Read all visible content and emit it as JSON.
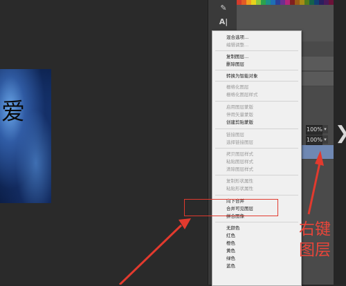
{
  "canvas": {
    "artwork_text": "爱"
  },
  "tools": {
    "text_tool_label": "A|"
  },
  "swatch_colors": [
    "#d23b2c",
    "#e35a25",
    "#f0a020",
    "#e7d21c",
    "#8cc63f",
    "#2ba24c",
    "#1d8f87",
    "#1e6fb4",
    "#2b3f97",
    "#6d2f90",
    "#b3267a",
    "#7f1f1f",
    "#9a5a16",
    "#a78b16",
    "#4f7d1d",
    "#14624a",
    "#123f73",
    "#2a1f5f",
    "#4a1a5a",
    "#6b1238"
  ],
  "layers_panel": {
    "opacity_1": "100%",
    "opacity_2": "100%",
    "dropdown_glyph": "▾"
  },
  "menu": {
    "items": [
      {
        "label": "混合选项...",
        "enabled": true
      },
      {
        "label": "编辑调整...",
        "enabled": false
      },
      {
        "label": "复制图层...",
        "enabled": true
      },
      {
        "label": "删除图层",
        "enabled": true
      },
      {
        "label": "转换为智能对象",
        "enabled": true
      },
      {
        "label": "栅格化图层",
        "enabled": false
      },
      {
        "label": "栅格化图层样式",
        "enabled": false
      },
      {
        "label": "启用图层蒙版",
        "enabled": false
      },
      {
        "label": "停用矢量蒙版",
        "enabled": false
      },
      {
        "label": "创建剪贴蒙版",
        "enabled": true
      },
      {
        "label": "链接图层",
        "enabled": false
      },
      {
        "label": "选择链接图层",
        "enabled": false
      },
      {
        "label": "拷贝图层样式",
        "enabled": false
      },
      {
        "label": "粘贴图层样式",
        "enabled": false
      },
      {
        "label": "清除图层样式",
        "enabled": false
      },
      {
        "label": "复制形状属性",
        "enabled": false
      },
      {
        "label": "粘贴形状属性",
        "enabled": false
      },
      {
        "label": "向下合并",
        "enabled": true
      },
      {
        "label": "合并可见图层",
        "enabled": true
      },
      {
        "label": "拼合图像",
        "enabled": true
      },
      {
        "label": "无颜色",
        "enabled": true
      },
      {
        "label": "红色",
        "enabled": true
      },
      {
        "label": "橙色",
        "enabled": true
      },
      {
        "label": "黄色",
        "enabled": true
      },
      {
        "label": "绿色",
        "enabled": true
      },
      {
        "label": "蓝色",
        "enabled": true
      }
    ]
  },
  "annotation": {
    "line1": "右键",
    "line2": "图层",
    "color": "#e8453a"
  }
}
